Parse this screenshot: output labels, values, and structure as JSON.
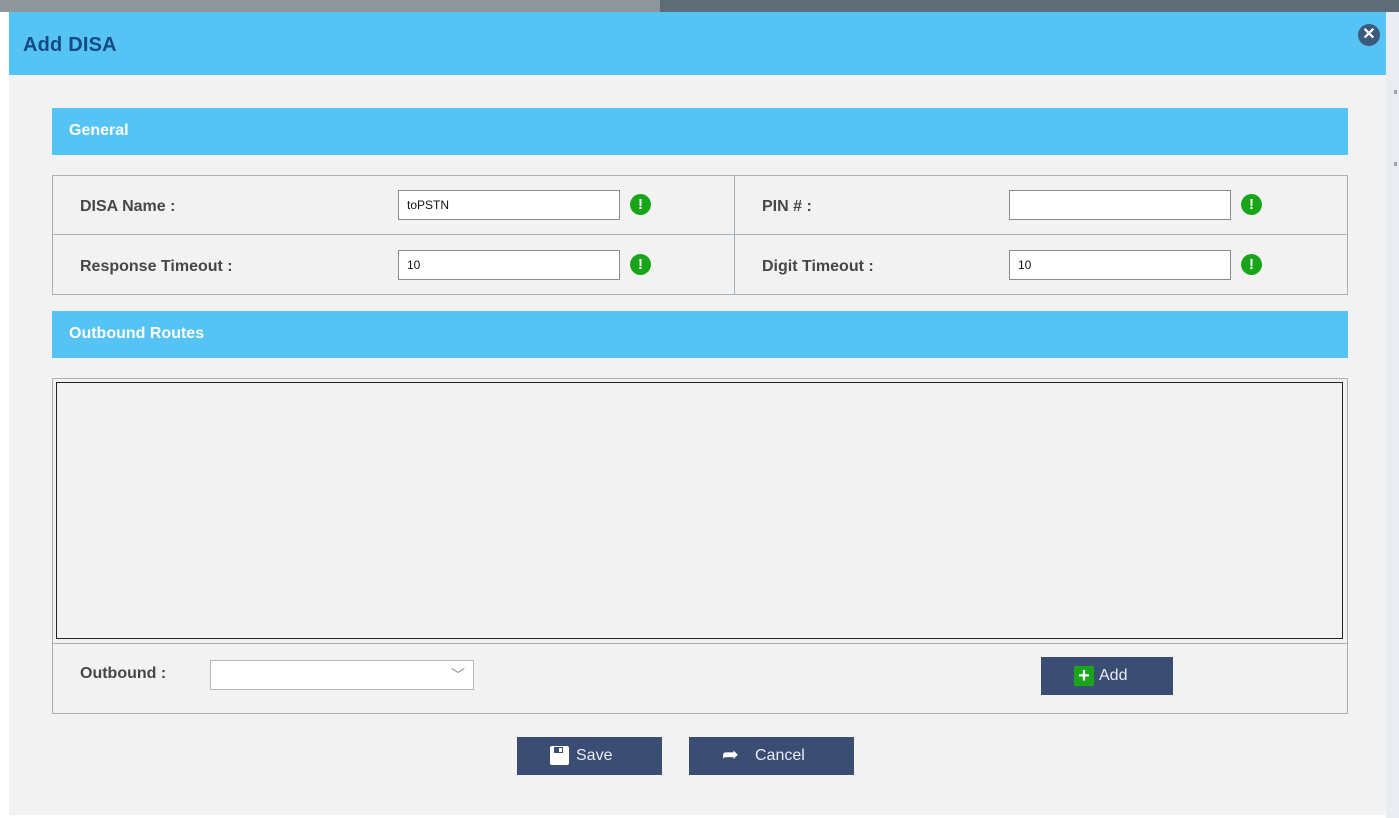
{
  "dialog": {
    "title": "Add DISA",
    "close_icon": "close-circle-icon"
  },
  "general": {
    "heading": "General",
    "disa_name": {
      "label": "DISA Name :",
      "value": "toPSTN"
    },
    "pin": {
      "label": "PIN # :",
      "value": ""
    },
    "response_timeout": {
      "label": "Response Timeout :",
      "value": "10"
    },
    "digit_timeout": {
      "label": "Digit Timeout :",
      "value": "10"
    },
    "warn_icon": "exclamation-icon",
    "warn_glyph": "!",
    "warn_color": "#19a519"
  },
  "outbound_routes": {
    "heading": "Outbound Routes",
    "outbound_label": "Outbound :",
    "outbound_selected": "",
    "add_label": "Add"
  },
  "footer": {
    "save_label": "Save",
    "cancel_label": "Cancel"
  },
  "colors": {
    "header_blue": "#55c3f4",
    "title_text": "#164a84",
    "button_bg": "#3b4d72",
    "panel_bg": "#f2f2f2"
  }
}
